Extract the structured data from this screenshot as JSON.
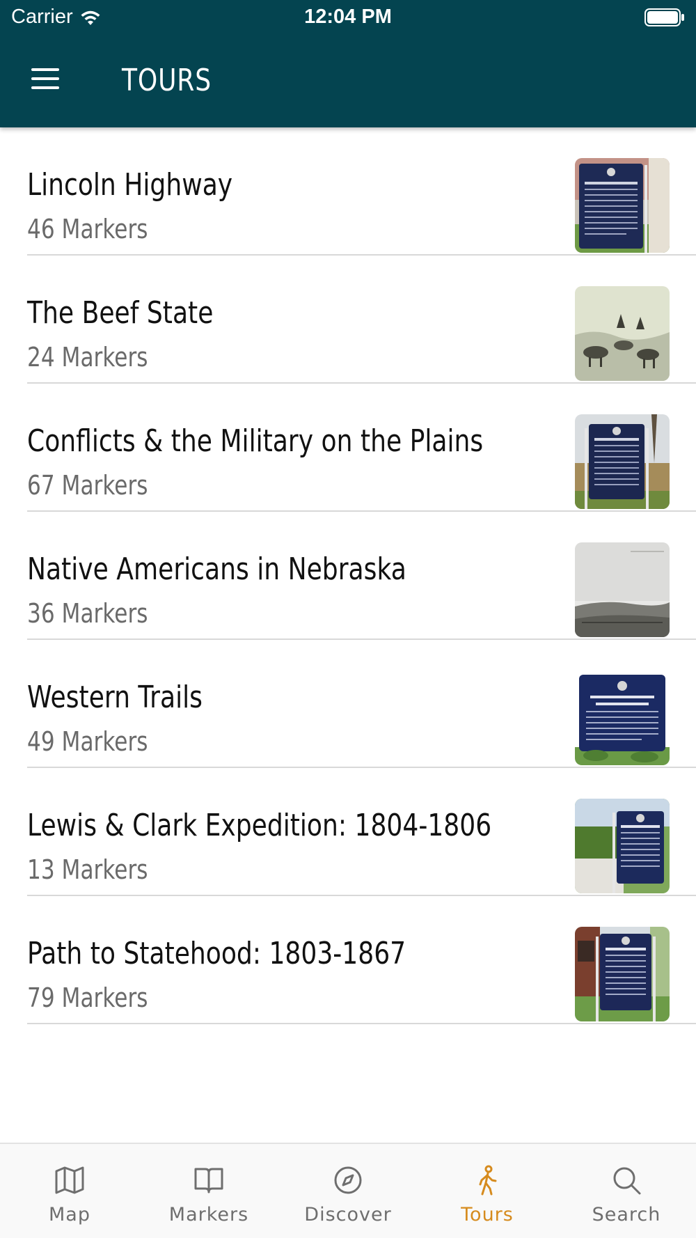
{
  "status_bar": {
    "carrier": "Carrier",
    "time": "12:04 PM"
  },
  "header": {
    "title": "TOURS",
    "background": "#044450"
  },
  "tours": [
    {
      "name": "Lincoln Highway",
      "count": "46 Markers",
      "thumb_icon": "historical-marker-photo"
    },
    {
      "name": "The Beef State",
      "count": "24 Markers",
      "thumb_icon": "cattle-sketch-photo"
    },
    {
      "name": "Conflicts & the Military on the Plains",
      "count": "67 Markers",
      "thumb_icon": "historical-marker-photo"
    },
    {
      "name": "Native Americans in Nebraska",
      "count": "36 Markers",
      "thumb_icon": "plains-landscape-photo"
    },
    {
      "name": "Western Trails",
      "count": "49 Markers",
      "thumb_icon": "historical-marker-photo"
    },
    {
      "name": "Lewis & Clark Expedition: 1804-1806",
      "count": "13 Markers",
      "thumb_icon": "historical-marker-photo"
    },
    {
      "name": "Path to Statehood: 1803-1867",
      "count": "79 Markers",
      "thumb_icon": "historical-marker-photo"
    }
  ],
  "tab_bar": {
    "active_color": "#d68b1e",
    "tabs": [
      {
        "label": "Map",
        "icon": "map-icon"
      },
      {
        "label": "Markers",
        "icon": "book-icon"
      },
      {
        "label": "Discover",
        "icon": "compass-icon"
      },
      {
        "label": "Tours",
        "icon": "walking-person-icon",
        "active": true
      },
      {
        "label": "Search",
        "icon": "search-icon"
      }
    ]
  }
}
